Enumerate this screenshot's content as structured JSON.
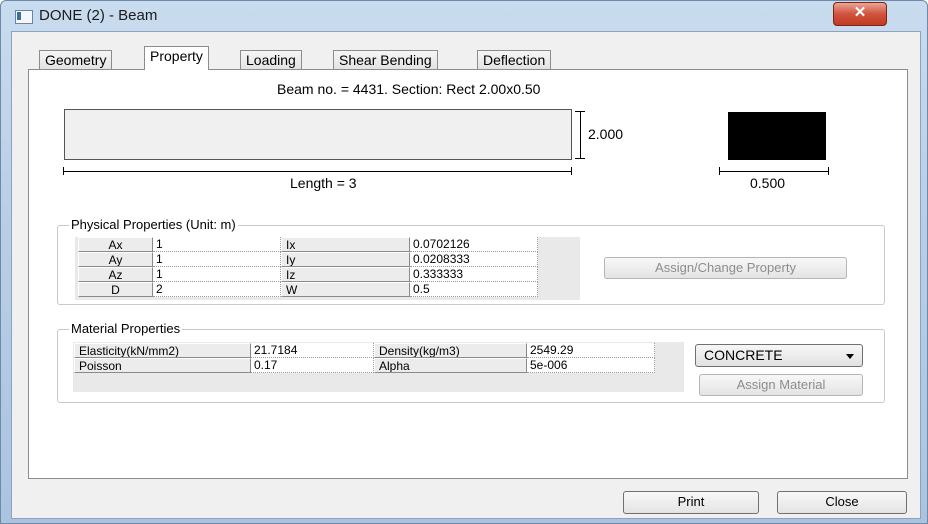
{
  "window": {
    "title": "DONE (2) - Beam",
    "close_glyph": "✕"
  },
  "tabs": [
    {
      "label": "Geometry"
    },
    {
      "label": "Property",
      "active": true
    },
    {
      "label": "Loading"
    },
    {
      "label": "Shear Bending"
    },
    {
      "label": "Deflection"
    }
  ],
  "section": {
    "caption": "Beam no. = 4431. Section: Rect 2.00x0.50",
    "height_label": "2.000",
    "length_label": "Length = 3",
    "width_label": "0.500"
  },
  "physical": {
    "title": "Physical Properties (Unit: m)",
    "rows": [
      {
        "k1": "Ax",
        "v1": "1",
        "k2": "Ix",
        "v2": "0.0702126"
      },
      {
        "k1": "Ay",
        "v1": "1",
        "k2": "Iy",
        "v2": "0.0208333"
      },
      {
        "k1": "Az",
        "v1": "1",
        "k2": "Iz",
        "v2": "0.333333"
      },
      {
        "k1": "D",
        "v1": "2",
        "k2": "W",
        "v2": "0.5"
      }
    ],
    "assign_button": "Assign/Change Property"
  },
  "material": {
    "title": "Material Properties",
    "rows": [
      {
        "k1": "Elasticity(kN/mm2)",
        "v1": "21.7184",
        "k2": "Density(kg/m3)",
        "v2": "2549.29"
      },
      {
        "k1": "Poisson",
        "v1": "0.17",
        "k2": "Alpha",
        "v2": "5e-006"
      }
    ],
    "combo_value": "CONCRETE",
    "assign_button": "Assign Material"
  },
  "footer": {
    "print": "Print",
    "close": "Close"
  },
  "icons": {
    "window_icon": "window-app-icon",
    "dropdown": "chevron-down-icon"
  }
}
